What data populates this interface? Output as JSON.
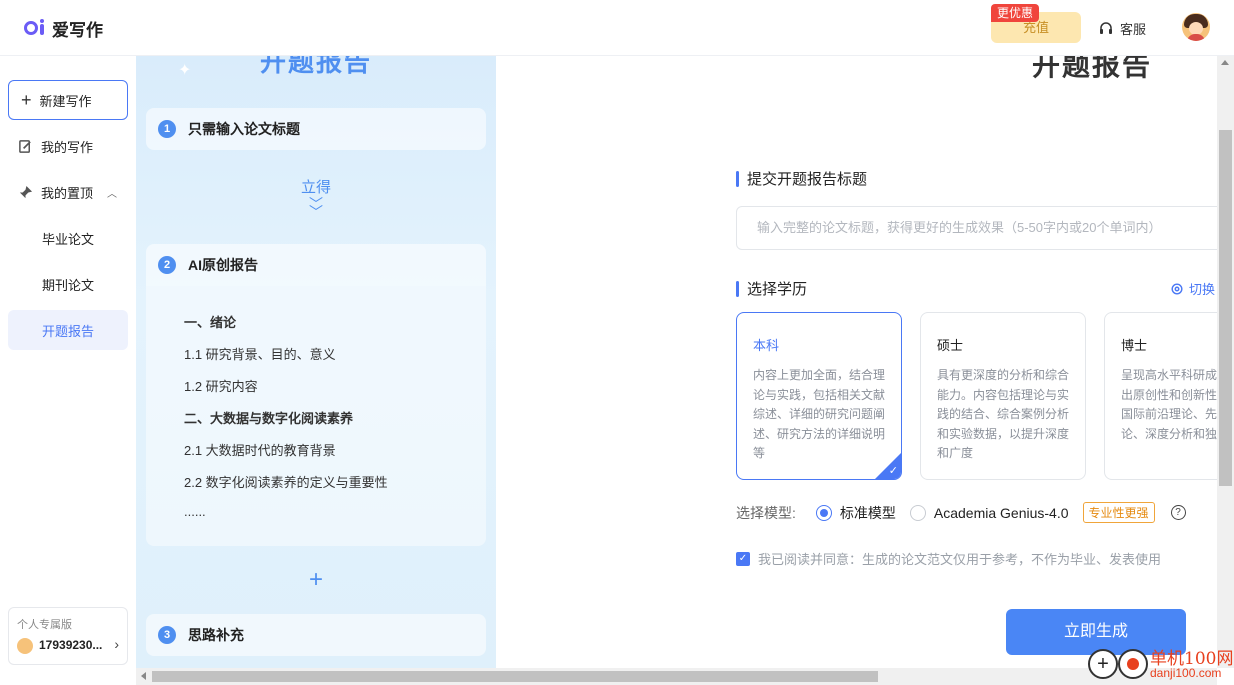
{
  "header": {
    "app_name": "爱写作",
    "recharge_label": "充值",
    "promo_badge": "更优惠",
    "service_label": "客服"
  },
  "sidebar": {
    "new_label": "新建写作",
    "items": [
      {
        "label": "我的写作",
        "icon": "edit-icon"
      },
      {
        "label": "我的置顶",
        "icon": "pin-icon"
      },
      {
        "label": "毕业论文"
      },
      {
        "label": "期刊论文"
      },
      {
        "label": "开题报告"
      }
    ],
    "account": {
      "version": "个人专属版",
      "user_id": "17939230..."
    }
  },
  "intro_panel": {
    "title": "开题报告",
    "step1": {
      "num": "1",
      "label": "只需输入论文标题"
    },
    "lide": "立得",
    "step2": {
      "num": "2",
      "label": "AI原创报告"
    },
    "outline": [
      "一、绪论",
      "1.1 研究背景、目的、意义",
      "1.2 研究内容",
      "二、大数据与数字化阅读素养",
      "2.1 大数据时代的教育背景",
      "2.2 数字化阅读素养的定义与重要性",
      "......"
    ],
    "plus": "+",
    "step3": {
      "num": "3",
      "label": "思路补充"
    }
  },
  "form": {
    "title": "开题报告",
    "title_section": "提交开题报告标题",
    "title_placeholder": "输入完整的论文标题，获得更好的生成效果（5-50字内或20个单词内）",
    "degree_section": "选择学历",
    "switch_label": "切换",
    "degrees": [
      {
        "name": "本科",
        "desc": "内容上更加全面，结合理论与实践，包括相关文献综述、详细的研究问题阐述、研究方法的详细说明等",
        "selected": true
      },
      {
        "name": "硕士",
        "desc": "具有更深度的分析和综合能力。内容包括理论与实践的结合、综合案例分析和实验数据，以提升深度和广度",
        "selected": false
      },
      {
        "name": "博士",
        "desc": "呈现高水平科研成果，突出原创性和创新性，融合国际前沿理论、先进方法论、深度分析和独到见解",
        "selected": false
      }
    ],
    "model_label": "选择模型:",
    "model_options": [
      {
        "label": "标准模型",
        "selected": true
      },
      {
        "label": "Academia Genius-4.0",
        "selected": false
      }
    ],
    "pro_tag": "专业性更强",
    "help": "?",
    "agree_text": "我已阅读并同意：生成的论文范文仅用于参考，不作为毕业、发表使用",
    "generate_label": "立即生成"
  },
  "watermark": {
    "cn": "单机100网",
    "url": "danji100.com"
  },
  "colors": {
    "accent": "#4a78f5",
    "brand": "#6b5cf6",
    "promo": "#f0453c",
    "tag": "#e58a10"
  }
}
